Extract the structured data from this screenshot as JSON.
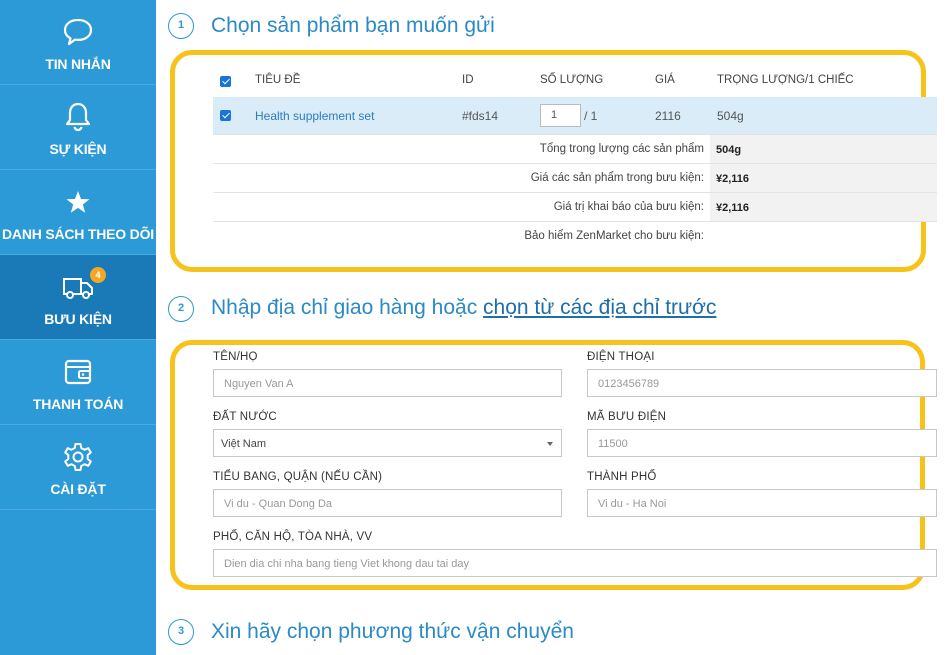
{
  "sidebar": {
    "items": [
      {
        "label": "TIN NHẮN",
        "icon": "chat-bubble-icon"
      },
      {
        "label": "SỰ KIỆN",
        "icon": "bell-icon"
      },
      {
        "label": "DANH SÁCH THEO DÕI",
        "icon": "star-icon"
      },
      {
        "label": "BƯU KIỆN",
        "icon": "truck-icon",
        "badge": "4",
        "active": true
      },
      {
        "label": "THANH TOÁN",
        "icon": "wallet-icon"
      },
      {
        "label": "CÀI ĐẶT",
        "icon": "gear-icon"
      }
    ]
  },
  "step1": {
    "number": "1",
    "title": "Chọn sản phẩm bạn muốn gửi",
    "table": {
      "headers": [
        "TIÊU ĐỀ",
        "ID",
        "SỐ LƯỢNG",
        "GIÁ",
        "TRỌNG LƯỢNG/1 CHIẾC"
      ],
      "rows": [
        {
          "title": "Health supplement set",
          "id": "#fds14",
          "qty": "1",
          "qty_max": "/ 1",
          "price": "2116",
          "weight": "504g",
          "checked": true
        }
      ]
    },
    "summary": [
      {
        "label": "Tổng trong lượng các sản phẩm",
        "value": "504g"
      },
      {
        "label": "Giá các sản phẩm trong bưu kiện:",
        "value": "¥2,116"
      },
      {
        "label": "Giá trị khai báo của bưu kiện:",
        "value": "¥2,116"
      },
      {
        "label": "Bảo hiểm ZenMarket cho bưu kiện:",
        "value": ""
      }
    ]
  },
  "step2": {
    "number": "2",
    "title": "Nhập địa chỉ giao hàng hoặc ",
    "link": "chọn từ các địa chỉ trước",
    "fields": {
      "name": {
        "label": "TÊN/HỌ",
        "placeholder": "Nguyen Van A"
      },
      "phone": {
        "label": "ĐIỆN THOẠI",
        "placeholder": "0123456789"
      },
      "country": {
        "label": "ĐẤT NƯỚC",
        "value": "Việt Nam"
      },
      "postal": {
        "label": "MÃ BƯU ĐIỆN",
        "placeholder": "11500"
      },
      "state": {
        "label": "TIỂU BANG, QUẬN (NẾU CẦN)",
        "placeholder": "Vi du - Quan Dong Da"
      },
      "city": {
        "label": "THÀNH PHỐ",
        "placeholder": "Vi du - Ha Noi"
      },
      "street": {
        "label": "PHỐ, CĂN HỘ, TÒA NHÀ, VV",
        "placeholder": "Dien dia chi nha bang tieng Viet khong dau tai day"
      }
    }
  },
  "step3": {
    "number": "3",
    "title": "Xin hãy chọn phương thức vận chuyển"
  },
  "colors": {
    "sidebar": "#2b9ad6",
    "sidebar_active": "#1a7ab8",
    "highlight": "#f7c219",
    "row_selected": "#d9ecf7",
    "badge": "#f5a623"
  }
}
